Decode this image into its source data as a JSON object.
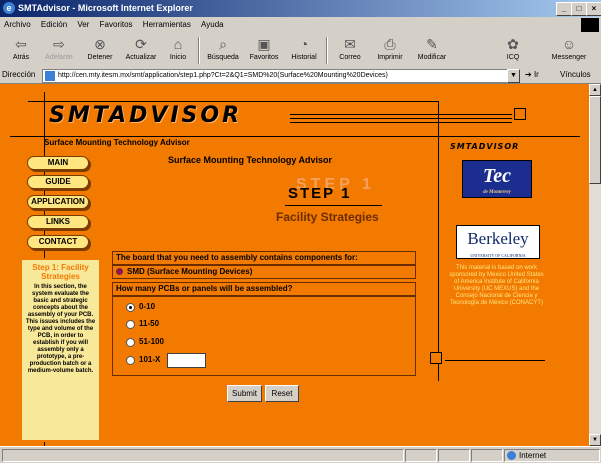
{
  "window": {
    "title": "SMTAdvisor - Microsoft Internet Explorer",
    "min_label": "_",
    "max_label": "□",
    "close_label": "×"
  },
  "menu": [
    "Archivo",
    "Edición",
    "Ver",
    "Favoritos",
    "Herramientas",
    "Ayuda"
  ],
  "toolbar": {
    "back": "Atrás",
    "forward": "Adelante",
    "stop": "Detener",
    "refresh": "Actualizar",
    "home": "Inicio",
    "search": "Búsqueda",
    "favorites": "Favoritos",
    "history": "Historial",
    "mail": "Correo",
    "print": "Imprimir",
    "edit": "Modificar",
    "icq": "ICQ",
    "messenger": "Messenger"
  },
  "address": {
    "label": "Dirección",
    "url": "http://cen.mty.itesm.mx/smt/application/step1.php?Ct=2&Q1=SMD%20(Surface%20Mounting%20Devices)",
    "go": "Ir",
    "links": "Vínculos"
  },
  "page": {
    "logo": "SMTADVISOR",
    "tagline": "Surface Mounting Technology Advisor",
    "center_title": "Surface Mounting Technology Advisor",
    "step_ghost": "STEP 1",
    "step": "STEP 1",
    "step_subtitle": "Facility Strategies",
    "nav": [
      "MAIN",
      "GUIDE",
      "APPLICATION",
      "LINKS",
      "CONTACT"
    ],
    "side_title": "Step 1: Facility Strategies",
    "side_text": "In this section, the system evaluate the basic and strategic concepts about the assembly of your PCB. This issues includes the type and volume of the PCB, in order to establish if you will assembly only a prototype, a pre-production batch or a medium-volume batch.",
    "q1": "The board that you need to assembly contains components for:",
    "a1": "SMD (Surface Mounting Devices)",
    "q2": "How many PCBs or panels will be assembled?",
    "options": [
      "0-10",
      "11-50",
      "51-100",
      "101-X"
    ],
    "selected_option": "0-10",
    "custom_value": "",
    "submit": "Submit",
    "reset": "Reset",
    "right_logo": "SMTADVISOR",
    "tec_logo": "Tec",
    "tec_sub": "de Monterrey",
    "berkeley_logo": "Berkeley",
    "berkeley_sub": "UNIVERSITY OF CALIFORNIA",
    "sponsor_text": "This material is based on work sponsored by Mexico United States of America Institute of California University (UC MEXUS) and the Consejo Nacional de Ciencia y Tecnología de México (CONACYT)"
  },
  "status": {
    "zone": "Internet"
  },
  "colors": {
    "page_bg": "#f27a00",
    "nav_button": "#ffe680",
    "accent": "#6b2d00"
  }
}
